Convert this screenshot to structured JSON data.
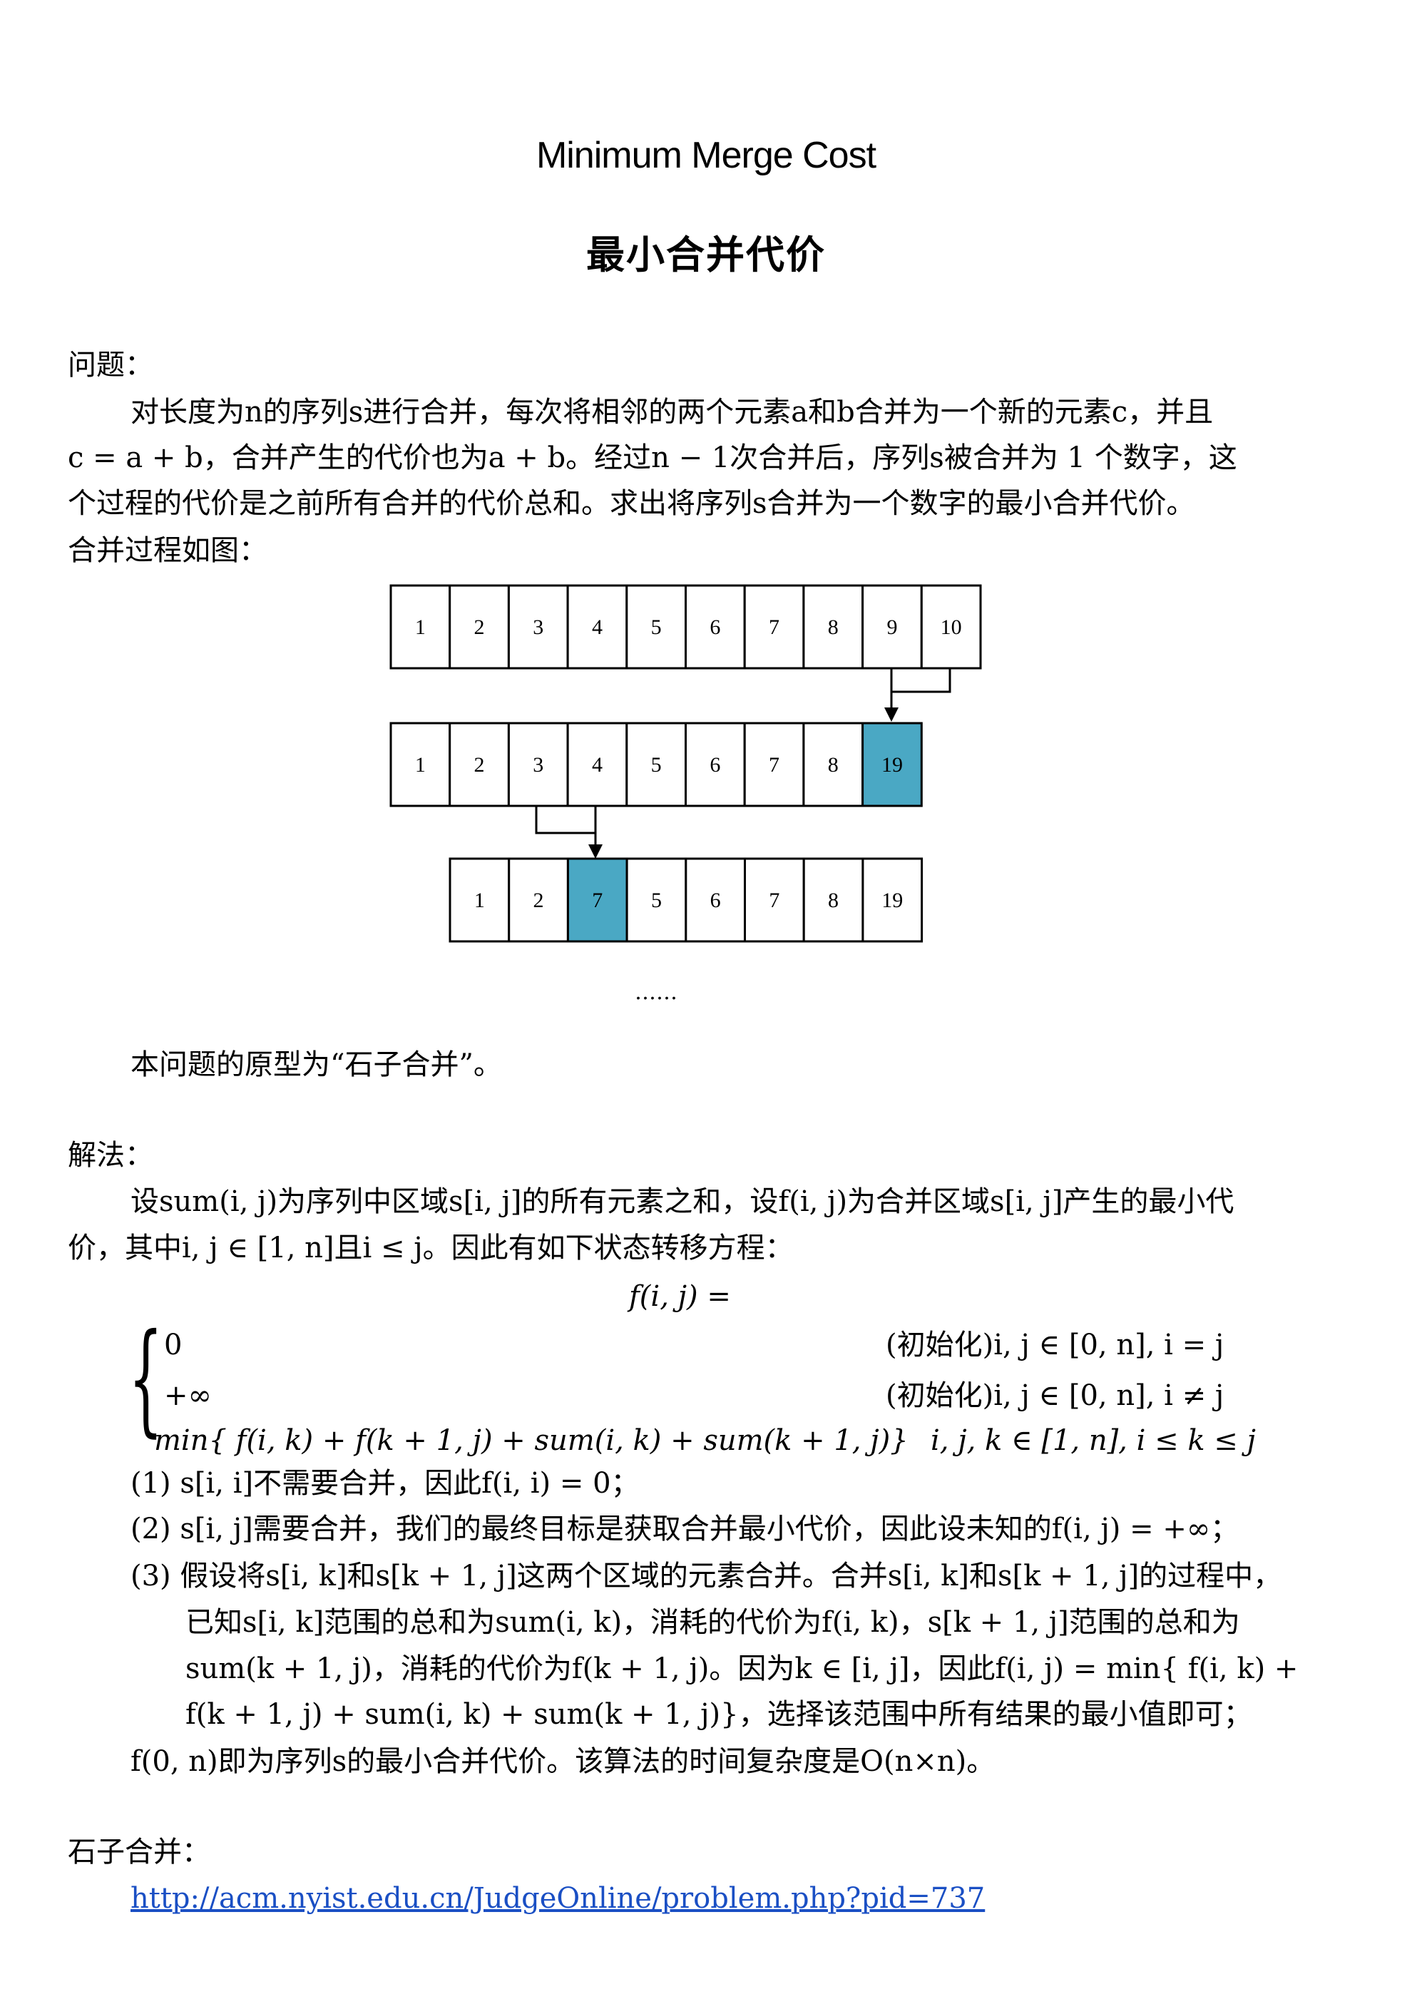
{
  "title_en": "Minimum Merge Cost",
  "title_cn": "最小合并代价",
  "problem": {
    "heading": "问题：",
    "p1": "对长度为n的序列s进行合并，每次将相邻的两个元素a和b合并为一个新的元素c，并且",
    "p2": "c = a + b，合并产生的代价也为a + b。经过n − 1次合并后，序列s被合并为 1 个数字，这",
    "p3": "个过程的代价是之前所有合并的代价总和。求出将序列s合并为一个数字的最小合并代价。",
    "p4": "合并过程如图："
  },
  "diagram": {
    "row1": [
      "1",
      "2",
      "3",
      "4",
      "5",
      "6",
      "7",
      "8",
      "9",
      "10"
    ],
    "row2": [
      "1",
      "2",
      "3",
      "4",
      "5",
      "6",
      "7",
      "8",
      "19"
    ],
    "row3": [
      "1",
      "2",
      "7",
      "5",
      "6",
      "7",
      "8",
      "19"
    ],
    "highlight_color": "#4aa8c4",
    "ellipsis": "……"
  },
  "prototype_note": "本问题的原型为“石子合并”。",
  "solution": {
    "heading": "解法：",
    "p1": "设sum(i, j)为序列中区域s[i, j]的所有元素之和，设f(i, j)为合并区域s[i, j]产生的最小代",
    "p2": "价，其中i, j ∈ [1, n]且i ≤ j。因此有如下状态转移方程：",
    "f_lhs": "f(i, j) =",
    "case1_expr": "0",
    "case1_cond": "(初始化)i, j ∈ [0, n], i = j",
    "case2_expr": "+∞",
    "case2_cond": "(初始化)i, j ∈ [0, n], i ≠ j",
    "case3_expr": "min{ f(i, k) + f(k + 1, j) + sum(i, k) + sum(k + 1, j)}",
    "case3_cond": "i, j, k ∈ [1, n], i ≤ k ≤ j",
    "item1": "(1)  s[i, i]不需要合并，因此f(i, i) = 0；",
    "item2": "(2)  s[i, j]需要合并，我们的最终目标是获取合并最小代价，因此设未知的f(i, j) = +∞；",
    "item3_l1": "(3)  假设将s[i, k]和s[k + 1, j]这两个区域的元素合并。合并s[i, k]和s[k + 1, j]的过程中，",
    "item3_l2": "已知s[i, k]范围的总和为sum(i, k)，消耗的代价为f(i, k)，s[k + 1, j]范围的总和为",
    "item3_l3": "sum(k + 1, j)，消耗的代价为f(k + 1, j)。因为k ∈ [i, j]，因此f(i, j) = min{ f(i, k) +",
    "item3_l4": "f(k + 1, j) + sum(i, k) + sum(k + 1, j)}，选择该范围中所有结果的最小值即可；",
    "conclusion": "f(0, n)即为序列s的最小合并代价。该算法的时间复杂度是O(n×n)。"
  },
  "reference": {
    "heading": "石子合并：",
    "url": "http://acm.nyist.edu.cn/JudgeOnline/problem.php?pid=737"
  }
}
